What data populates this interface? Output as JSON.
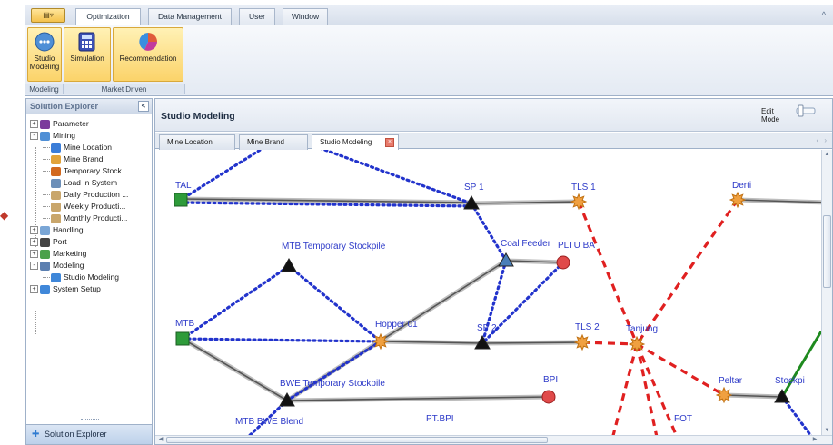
{
  "ribbon": {
    "app_button_label": "",
    "tabs": [
      {
        "label": "Optimization",
        "active": true
      },
      {
        "label": "Data Management",
        "active": false
      },
      {
        "label": "User",
        "active": false
      },
      {
        "label": "Window",
        "active": false
      }
    ],
    "collapse_glyph": "^",
    "buttons": [
      {
        "label": "Studio Modeling",
        "icon": "studio-modeling-icon"
      },
      {
        "label": "Simulation",
        "icon": "simulation-icon"
      },
      {
        "label": "Recommendation",
        "icon": "recommendation-icon"
      }
    ],
    "groups": [
      {
        "label": "Modeling"
      },
      {
        "label": "Market Driven"
      }
    ]
  },
  "explorer": {
    "title": "Solution Explorer",
    "collapse_glyph": "<",
    "footer_label": "Solution Explorer",
    "tree": [
      {
        "label": "Parameter",
        "expander": "+",
        "icon": "parameter-icon",
        "icon_color": "#7b3a9c"
      },
      {
        "label": "Mining",
        "expander": "-",
        "icon": "mining-icon",
        "icon_color": "#4f8fd6"
      },
      {
        "label": "Mine Location",
        "icon": "location-icon",
        "icon_color": "#3b7dd8"
      },
      {
        "label": "Mine Brand",
        "icon": "brand-icon",
        "icon_color": "#e2a33a"
      },
      {
        "label": "Temporary Stock...",
        "icon": "stockpile-icon",
        "icon_color": "#d2691e"
      },
      {
        "label": "Load In System",
        "icon": "load-icon",
        "icon_color": "#6c8fb8"
      },
      {
        "label": "Daily Production ...",
        "icon": "daily-production-icon",
        "icon_color": "#c9a66b"
      },
      {
        "label": "Weekly Producti...",
        "icon": "weekly-production-icon",
        "icon_color": "#c9a66b"
      },
      {
        "label": "Monthly Producti...",
        "icon": "monthly-production-icon",
        "icon_color": "#c9a66b"
      },
      {
        "label": "Handling",
        "expander": "+",
        "icon": "handling-icon",
        "icon_color": "#7aa6d6"
      },
      {
        "label": "Port",
        "expander": "+",
        "icon": "port-icon",
        "icon_color": "#444444"
      },
      {
        "label": "Marketing",
        "expander": "+",
        "icon": "marketing-icon",
        "icon_color": "#4aa14a"
      },
      {
        "label": "Modeling",
        "expander": "-",
        "icon": "modeling-icon",
        "icon_color": "#5b7fb0"
      },
      {
        "label": "Studio Modeling",
        "icon": "studio-modeling-icon",
        "icon_color": "#3f87d9"
      },
      {
        "label": "System Setup",
        "expander": "+",
        "icon": "system-setup-icon",
        "icon_color": "#3f87d9"
      }
    ]
  },
  "workspace": {
    "title": "Studio Modeling",
    "edit_mode_label": "Edit Mode",
    "doc_tabs": [
      {
        "label": "Mine Location",
        "active": false
      },
      {
        "label": "Mine Brand",
        "active": false
      },
      {
        "label": "Studio Modeling",
        "active": true
      }
    ],
    "tab_close_glyph": "×",
    "tab_nav_glyph": "‹ ›",
    "scroll_up": "▲",
    "scroll_down": "▼",
    "scroll_left": "◀",
    "scroll_right": "▶"
  },
  "diagram": {
    "nodes": [
      {
        "id": "tal",
        "label": "TAL",
        "shape": "square",
        "color": "#2e9b3a"
      },
      {
        "id": "sp1",
        "label": "SP 1",
        "shape": "triangle",
        "color": "#111111"
      },
      {
        "id": "tls1",
        "label": "TLS 1",
        "shape": "star",
        "color": "#f0a040"
      },
      {
        "id": "derti",
        "label": "Derti",
        "shape": "star",
        "color": "#f0a040"
      },
      {
        "id": "mtbtemp",
        "label": "MTB Temporary Stockpile",
        "shape": "triangle",
        "color": "#111111"
      },
      {
        "id": "coalfeeder",
        "label": "Coal Feeder",
        "shape": "triangle",
        "color": "#4a7fb8"
      },
      {
        "id": "pltuba",
        "label": "PLTU BA",
        "shape": "circle",
        "color": "#e04a4a"
      },
      {
        "id": "mtb",
        "label": "MTB",
        "shape": "square",
        "color": "#2e9b3a"
      },
      {
        "id": "hopper01",
        "label": "Hopper 01",
        "shape": "star",
        "color": "#f0a040"
      },
      {
        "id": "sp2",
        "label": "SP 2",
        "shape": "triangle",
        "color": "#111111"
      },
      {
        "id": "tls2",
        "label": "TLS 2",
        "shape": "star",
        "color": "#f0a040"
      },
      {
        "id": "tanjung",
        "label": "Tanjung",
        "shape": "star",
        "color": "#f0a040"
      },
      {
        "id": "bwetemp",
        "label": "BWE Temporary Stockpile",
        "shape": "triangle",
        "color": "#111111"
      },
      {
        "id": "bpi",
        "label": "BPI",
        "shape": "circle",
        "color": "#e04a4a"
      },
      {
        "id": "peltar",
        "label": "Peltar",
        "shape": "star",
        "color": "#f0a040"
      },
      {
        "id": "stockpile",
        "label": "Stockpi",
        "shape": "triangle",
        "color": "#111111"
      },
      {
        "id": "mtbbwe",
        "label": "MTB BWE Blend",
        "shape": "none",
        "color": "#111111"
      },
      {
        "id": "ptbpi",
        "label": "PT.BPI",
        "shape": "none",
        "color": "#111111"
      },
      {
        "id": "fot",
        "label": "FOT",
        "shape": "none",
        "color": "#111111"
      }
    ],
    "edge_colors": {
      "conveyor": "#555555",
      "truck": "#2233cc",
      "barge": "#e02020",
      "rail": "#1e8a1e"
    },
    "edges": [
      {
        "from": "tal",
        "to": "sp1",
        "type": "conveyor"
      },
      {
        "from": "tal",
        "to": "sp1",
        "type": "truck"
      },
      {
        "from": "sp1",
        "to": "tls1",
        "type": "conveyor"
      },
      {
        "from": "sp1",
        "to": "coalfeeder",
        "type": "truck"
      },
      {
        "from": "coalfeeder",
        "to": "pltuba",
        "type": "conveyor"
      },
      {
        "from": "coalfeeder",
        "to": "sp2",
        "type": "truck"
      },
      {
        "from": "pltuba",
        "to": "sp2",
        "type": "truck"
      },
      {
        "from": "mtb",
        "to": "mtbtemp",
        "type": "truck"
      },
      {
        "from": "mtbtemp",
        "to": "hopper01",
        "type": "truck"
      },
      {
        "from": "mtb",
        "to": "hopper01",
        "type": "truck"
      },
      {
        "from": "mtb",
        "to": "bwetemp",
        "type": "conveyor"
      },
      {
        "from": "bwetemp",
        "to": "coalfeeder",
        "type": "conveyor"
      },
      {
        "from": "hopper01",
        "to": "sp2",
        "type": "conveyor"
      },
      {
        "from": "sp2",
        "to": "tls2",
        "type": "conveyor"
      },
      {
        "from": "bwetemp",
        "to": "bpi",
        "type": "conveyor"
      },
      {
        "from": "hopper01",
        "to": "bwetemp",
        "type": "truck"
      },
      {
        "from": "tls1",
        "to": "tanjung",
        "type": "barge"
      },
      {
        "from": "derti",
        "to": "tanjung",
        "type": "barge"
      },
      {
        "from": "tls2",
        "to": "tanjung",
        "type": "barge"
      },
      {
        "from": "tanjung",
        "to": "peltar",
        "type": "barge"
      },
      {
        "from": "peltar",
        "to": "stockpile",
        "type": "conveyor"
      },
      {
        "from": "derti",
        "to": "offscreen_right",
        "type": "conveyor"
      },
      {
        "from": "stockpile",
        "to": "offscreen_topright",
        "type": "rail"
      },
      {
        "from": "stockpile",
        "to": "offscreen_bottomright",
        "type": "truck"
      },
      {
        "from": "tanjung",
        "to": "fot",
        "type": "barge"
      },
      {
        "from": "tanjung",
        "to": "offscreen_bottomleft",
        "type": "barge"
      },
      {
        "from": "tanjung",
        "to": "offscreen_bottom",
        "type": "barge"
      },
      {
        "from": "bwetemp",
        "to": "mtbbwe",
        "type": "truck"
      },
      {
        "from": "offscreen_topleft",
        "to": "sp1",
        "type": "truck"
      },
      {
        "from": "offscreen_top",
        "to": "tal",
        "type": "truck"
      }
    ]
  }
}
